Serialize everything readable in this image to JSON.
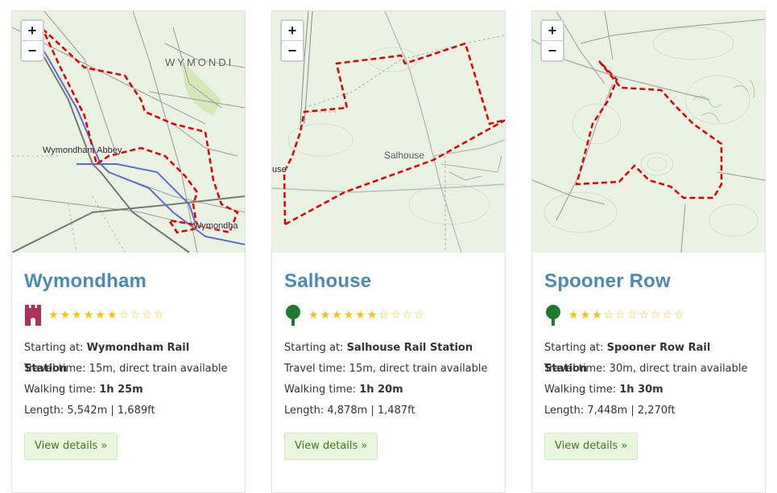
{
  "colors": {
    "title": "#4a8ab5",
    "star": "#f4c20d",
    "route": "#e00000",
    "castle_icon": "#b0305a",
    "tree_icon": "#1f7a2f",
    "button_bg": "#eaf6dd",
    "button_text": "#3d7a1f"
  },
  "map_controls": {
    "zoom_in": "+",
    "zoom_out": "−"
  },
  "cards": [
    {
      "title": "Wymondham",
      "icon": "castle-icon",
      "rating": 6,
      "max_rating": 10,
      "map_labels": {
        "town": "WYMONDI",
        "abbey": "Wymondham Abbey",
        "station": "Wymondha"
      },
      "starting_label": "Starting at:",
      "starting_value": "Wymondham Rail Station",
      "travel_label": "Travel time:",
      "travel_value": "15m, direct train available",
      "walking_label": "Walking time:",
      "walking_value": "1h 25m",
      "length_label": "Length:",
      "length_value": "5,542m | 1,689ft",
      "button": "View details »"
    },
    {
      "title": "Salhouse",
      "icon": "tree-icon",
      "rating": 6,
      "max_rating": 10,
      "map_labels": {
        "village": "Salhouse",
        "edge": "use"
      },
      "starting_label": "Starting at:",
      "starting_value": "Salhouse Rail Station",
      "travel_label": "Travel time:",
      "travel_value": "15m, direct train available",
      "walking_label": "Walking time:",
      "walking_value": "1h 20m",
      "length_label": "Length:",
      "length_value": "4,878m | 1,487ft",
      "button": "View details »"
    },
    {
      "title": "Spooner Row",
      "icon": "tree-icon",
      "rating": 3,
      "max_rating": 10,
      "map_labels": {},
      "starting_label": "Starting at:",
      "starting_value": "Spooner Row Rail Station",
      "travel_label": "Travel time:",
      "travel_value": "30m, direct train available",
      "walking_label": "Walking time:",
      "walking_value": "1h 30m",
      "length_label": "Length:",
      "length_value": "7,448m | 2,270ft",
      "button": "View details »"
    }
  ]
}
